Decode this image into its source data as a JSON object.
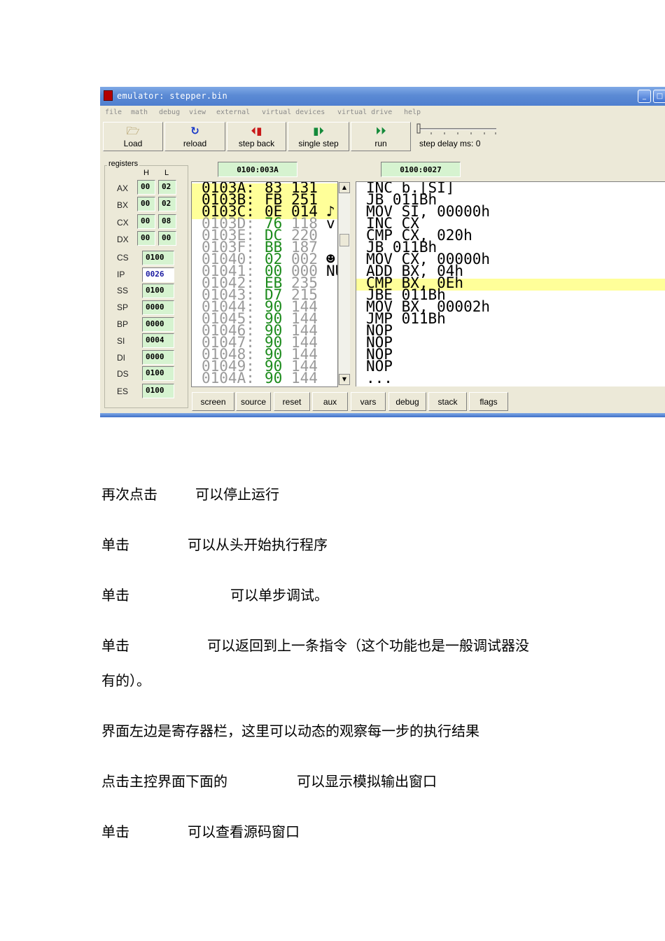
{
  "emulator": {
    "title": "emulator: stepper.bin",
    "menu": [
      "file",
      "math",
      "debug",
      "view",
      "external",
      "virtual devices",
      "virtual drive",
      "help"
    ],
    "toolbar": [
      {
        "label": "Load",
        "icon": "open-folder-icon"
      },
      {
        "label": "reload",
        "icon": "reload-icon"
      },
      {
        "label": "step back",
        "icon": "step-back-icon"
      },
      {
        "label": "single step",
        "icon": "single-step-icon"
      },
      {
        "label": "run",
        "icon": "run-icon"
      }
    ],
    "step_delay_label": "step delay ms: 0",
    "registers_label": "registers",
    "h_label": "H",
    "l_label": "L",
    "registers_hl": [
      {
        "name": "AX",
        "h": "00",
        "l": "02"
      },
      {
        "name": "BX",
        "h": "00",
        "l": "02"
      },
      {
        "name": "CX",
        "h": "00",
        "l": "08"
      },
      {
        "name": "DX",
        "h": "00",
        "l": "00"
      }
    ],
    "registers_seg": [
      {
        "name": "CS",
        "value": "0100"
      },
      {
        "name": "IP",
        "value": "0026"
      },
      {
        "name": "SS",
        "value": "0100"
      },
      {
        "name": "SP",
        "value": "0000"
      },
      {
        "name": "BP",
        "value": "0000"
      },
      {
        "name": "SI",
        "value": "0004"
      },
      {
        "name": "DI",
        "value": "0000"
      },
      {
        "name": "DS",
        "value": "0100"
      },
      {
        "name": "ES",
        "value": "0100"
      }
    ],
    "memory_address": "0100:003A",
    "disasm_address": "0100:0027",
    "memory": [
      {
        "addr": "0103A:",
        "hex": "83",
        "dec": "131",
        "ch": ""
      },
      {
        "addr": "0103B:",
        "hex": "FB",
        "dec": "251",
        "ch": ""
      },
      {
        "addr": "0103C:",
        "hex": "0E",
        "dec": "014",
        "ch": "♪"
      },
      {
        "addr": "0103D:",
        "hex": "76",
        "dec": "118",
        "ch": "v"
      },
      {
        "addr": "0103E:",
        "hex": "DC",
        "dec": "220",
        "ch": ""
      },
      {
        "addr": "0103F:",
        "hex": "BB",
        "dec": "187",
        "ch": ""
      },
      {
        "addr": "01040:",
        "hex": "02",
        "dec": "002",
        "ch": "☻"
      },
      {
        "addr": "01041:",
        "hex": "00",
        "dec": "000",
        "ch": "NU"
      },
      {
        "addr": "01042:",
        "hex": "EB",
        "dec": "235",
        "ch": ""
      },
      {
        "addr": "01043:",
        "hex": "D7",
        "dec": "215",
        "ch": ""
      },
      {
        "addr": "01044:",
        "hex": "90",
        "dec": "144",
        "ch": ""
      },
      {
        "addr": "01045:",
        "hex": "90",
        "dec": "144",
        "ch": ""
      },
      {
        "addr": "01046:",
        "hex": "90",
        "dec": "144",
        "ch": ""
      },
      {
        "addr": "01047:",
        "hex": "90",
        "dec": "144",
        "ch": ""
      },
      {
        "addr": "01048:",
        "hex": "90",
        "dec": "144",
        "ch": ""
      },
      {
        "addr": "01049:",
        "hex": "90",
        "dec": "144",
        "ch": ""
      },
      {
        "addr": "0104A:",
        "hex": "90",
        "dec": "144",
        "ch": ""
      }
    ],
    "disassembly": [
      "INC b.[SI]",
      "JB 011Bh",
      "MOV SI, 00000h",
      "INC CX",
      "CMP CX, 020h",
      "JB 011Bh",
      "MOV CX, 00000h",
      "ADD BX, 04h",
      "CMP BX, 0Eh",
      "JBE 011Bh",
      "MOV BX, 00002h",
      "JMP 011Bh",
      "NOP",
      "NOP",
      "NOP",
      "NOP",
      "..."
    ],
    "bottom_buttons": [
      "screen",
      "source",
      "reset",
      "aux",
      "vars",
      "debug",
      "stack",
      "flags"
    ]
  },
  "document": {
    "p1_a": "再次点击",
    "p1_b": "可以停止运行",
    "p2_a": "单击",
    "p2_b": "可以从头开始执行程序",
    "p3_a": "单击",
    "p3_b": "可以单步调试。",
    "p4_a": "单击",
    "p4_b": "可以返回到上一条指令（这个功能也是一般调试器没",
    "p4_c": "有的）。",
    "p5": "界面左边是寄存器栏，这里可以动态的观察每一步的执行结果",
    "p6_a": "点击主控界面下面的",
    "p6_b": "可以显示模拟输出窗口",
    "p7_a": "单击",
    "p7_b": "可以查看源码窗口"
  }
}
